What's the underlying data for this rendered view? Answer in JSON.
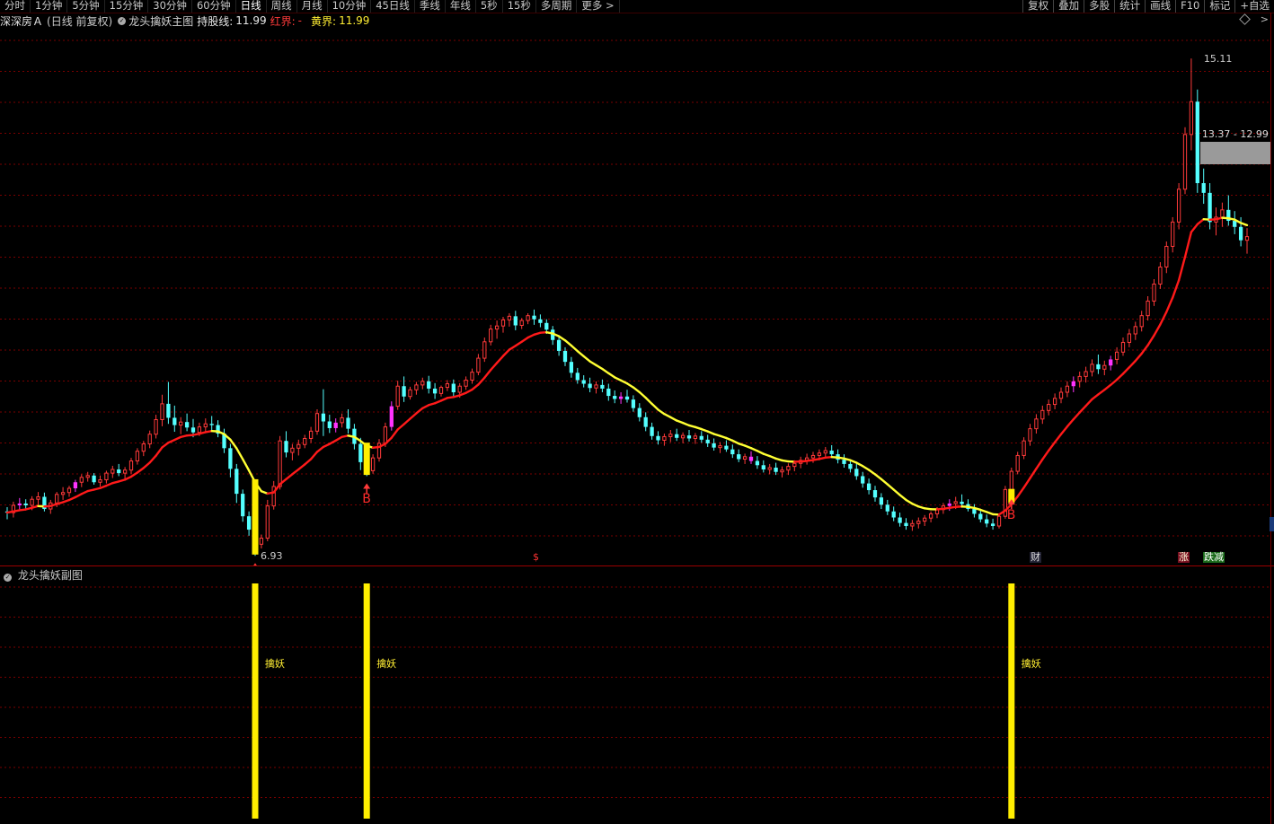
{
  "toolbar": {
    "left_items": [
      "分时",
      "1分钟",
      "5分钟",
      "15分钟",
      "30分钟",
      "60分钟",
      "日线",
      "周线",
      "月线",
      "10分钟",
      "45日线",
      "季线",
      "年线",
      "5秒",
      "15秒",
      "多周期",
      "更多 >"
    ],
    "active_index": 6,
    "right_items": [
      "复权",
      "叠加",
      "多股",
      "统计",
      "画线",
      "F10",
      "标记",
      "+自选"
    ]
  },
  "infobar": {
    "stock": "深深房Ａ",
    "period": "(日线 前复权)",
    "indicator": "龙头擒妖主图",
    "hold_label": "持股线:",
    "hold_value": "11.99",
    "red_label": "红界:",
    "red_value": "-",
    "yellow_label": "黄界:",
    "yellow_value": "11.99"
  },
  "annotations": {
    "low_price": "6.93",
    "high_price": "15.11",
    "range_label": "13.37 - 12.99",
    "buy_letter": "B",
    "dollar_mark": "$",
    "cai_tag": "财",
    "zhang_tag": "涨",
    "jian_tag": "跌减"
  },
  "sub_chart": {
    "title": "龙头擒妖副图",
    "signal_label": "擒妖"
  },
  "colors": {
    "up": "#ff3a3a",
    "down": "#54ffff",
    "highlight": "#ff33ff",
    "signal": "#ffee00",
    "hold_red": "#ff1a1a",
    "hold_yellow": "#ffff33",
    "grid": "#7a0000"
  },
  "chart_data": {
    "type": "candlestick",
    "price_range": [
      6.8,
      15.6
    ],
    "buy_signals": [
      40,
      58,
      162
    ],
    "ohlc": [
      [
        7.66,
        7.73,
        7.53,
        7.64
      ],
      [
        7.64,
        7.82,
        7.56,
        7.76
      ],
      [
        7.76,
        7.88,
        7.67,
        7.79
      ],
      [
        7.79,
        7.86,
        7.7,
        7.76
      ],
      [
        7.76,
        7.91,
        7.68,
        7.86
      ],
      [
        7.86,
        7.98,
        7.77,
        7.9
      ],
      [
        7.9,
        7.97,
        7.66,
        7.7
      ],
      [
        7.7,
        7.85,
        7.62,
        7.8
      ],
      [
        7.8,
        7.98,
        7.73,
        7.94
      ],
      [
        7.94,
        8.06,
        7.85,
        7.97
      ],
      [
        7.97,
        8.08,
        7.9,
        8.04
      ],
      [
        8.04,
        8.18,
        7.98,
        8.14
      ],
      [
        8.14,
        8.27,
        8.06,
        8.22
      ],
      [
        8.22,
        8.31,
        8.15,
        8.25
      ],
      [
        8.25,
        8.29,
        8.1,
        8.14
      ],
      [
        8.14,
        8.25,
        8.07,
        8.18
      ],
      [
        8.18,
        8.33,
        8.12,
        8.29
      ],
      [
        8.29,
        8.41,
        8.21,
        8.35
      ],
      [
        8.35,
        8.44,
        8.24,
        8.29
      ],
      [
        8.29,
        8.39,
        8.19,
        8.34
      ],
      [
        8.34,
        8.54,
        8.28,
        8.49
      ],
      [
        8.49,
        8.7,
        8.43,
        8.65
      ],
      [
        8.65,
        8.82,
        8.57,
        8.77
      ],
      [
        8.77,
        8.99,
        8.7,
        8.93
      ],
      [
        8.93,
        9.25,
        8.86,
        9.17
      ],
      [
        9.17,
        9.58,
        9.06,
        9.43
      ],
      [
        9.43,
        9.79,
        9.1,
        9.2
      ],
      [
        9.2,
        9.4,
        8.97,
        9.08
      ],
      [
        9.08,
        9.21,
        8.93,
        9.13
      ],
      [
        9.13,
        9.27,
        8.98,
        9.04
      ],
      [
        9.04,
        9.18,
        8.88,
        8.96
      ],
      [
        8.96,
        9.12,
        8.9,
        9.05
      ],
      [
        9.05,
        9.19,
        8.97,
        9.1
      ],
      [
        9.1,
        9.23,
        9.0,
        9.08
      ],
      [
        9.08,
        9.16,
        8.88,
        8.94
      ],
      [
        8.94,
        9.02,
        8.62,
        8.7
      ],
      [
        8.7,
        8.77,
        8.22,
        8.36
      ],
      [
        8.36,
        8.44,
        7.8,
        7.95
      ],
      [
        7.95,
        8.02,
        7.49,
        7.58
      ],
      [
        7.58,
        7.66,
        7.26,
        7.36
      ],
      [
        7.36,
        7.45,
        6.93,
        7.12
      ],
      [
        7.12,
        7.28,
        7.05,
        7.22
      ],
      [
        7.22,
        7.85,
        7.17,
        7.75
      ],
      [
        7.75,
        8.16,
        7.69,
        8.07
      ],
      [
        8.07,
        8.9,
        8.02,
        8.82
      ],
      [
        8.82,
        8.98,
        8.55,
        8.63
      ],
      [
        8.63,
        8.77,
        8.5,
        8.7
      ],
      [
        8.7,
        8.84,
        8.58,
        8.76
      ],
      [
        8.76,
        8.92,
        8.7,
        8.86
      ],
      [
        8.86,
        9.05,
        8.79,
        8.98
      ],
      [
        8.98,
        9.34,
        8.92,
        9.27
      ],
      [
        9.27,
        9.67,
        8.9,
        9.14
      ],
      [
        9.14,
        9.25,
        8.95,
        9.03
      ],
      [
        9.03,
        9.19,
        8.96,
        9.12
      ],
      [
        9.12,
        9.27,
        9.04,
        9.2
      ],
      [
        9.2,
        9.34,
        8.94,
        9.02
      ],
      [
        9.02,
        9.1,
        8.68,
        8.77
      ],
      [
        8.77,
        8.87,
        8.34,
        8.47
      ],
      [
        8.47,
        8.56,
        8.24,
        8.33
      ],
      [
        8.33,
        8.6,
        8.28,
        8.54
      ],
      [
        8.54,
        8.85,
        8.48,
        8.78
      ],
      [
        8.78,
        9.12,
        8.72,
        9.05
      ],
      [
        9.05,
        9.47,
        8.99,
        9.39
      ],
      [
        9.39,
        9.81,
        9.33,
        9.72
      ],
      [
        9.72,
        9.88,
        9.46,
        9.55
      ],
      [
        9.55,
        9.71,
        9.5,
        9.66
      ],
      [
        9.66,
        9.79,
        9.58,
        9.74
      ],
      [
        9.74,
        9.86,
        9.67,
        9.8
      ],
      [
        9.8,
        9.89,
        9.6,
        9.68
      ],
      [
        9.68,
        9.77,
        9.51,
        9.6
      ],
      [
        9.6,
        9.73,
        9.55,
        9.7
      ],
      [
        9.7,
        9.82,
        9.64,
        9.76
      ],
      [
        9.76,
        9.83,
        9.55,
        9.62
      ],
      [
        9.62,
        9.77,
        9.53,
        9.72
      ],
      [
        9.72,
        9.88,
        9.66,
        9.82
      ],
      [
        9.82,
        10.01,
        9.76,
        9.95
      ],
      [
        9.95,
        10.25,
        9.9,
        10.18
      ],
      [
        10.18,
        10.52,
        10.12,
        10.45
      ],
      [
        10.45,
        10.73,
        10.39,
        10.66
      ],
      [
        10.66,
        10.8,
        10.5,
        10.71
      ],
      [
        10.71,
        10.86,
        10.6,
        10.81
      ],
      [
        10.81,
        10.92,
        10.7,
        10.87
      ],
      [
        10.87,
        10.96,
        10.64,
        10.72
      ],
      [
        10.72,
        10.84,
        10.66,
        10.8
      ],
      [
        10.8,
        10.92,
        10.74,
        10.88
      ],
      [
        10.88,
        10.98,
        10.73,
        10.82
      ],
      [
        10.82,
        10.9,
        10.69,
        10.76
      ],
      [
        10.76,
        10.82,
        10.58,
        10.65
      ],
      [
        10.65,
        10.71,
        10.4,
        10.48
      ],
      [
        10.48,
        10.55,
        10.22,
        10.3
      ],
      [
        10.3,
        10.36,
        10.05,
        10.12
      ],
      [
        10.12,
        10.2,
        9.86,
        9.94
      ],
      [
        9.94,
        10.02,
        9.76,
        9.82
      ],
      [
        9.82,
        9.9,
        9.7,
        9.76
      ],
      [
        9.76,
        9.86,
        9.62,
        9.69
      ],
      [
        9.69,
        9.8,
        9.6,
        9.74
      ],
      [
        9.74,
        9.83,
        9.62,
        9.68
      ],
      [
        9.68,
        9.76,
        9.48,
        9.56
      ],
      [
        9.56,
        9.65,
        9.44,
        9.51
      ],
      [
        9.51,
        9.62,
        9.43,
        9.55
      ],
      [
        9.55,
        9.66,
        9.45,
        9.5
      ],
      [
        9.5,
        9.57,
        9.3,
        9.36
      ],
      [
        9.36,
        9.44,
        9.14,
        9.21
      ],
      [
        9.21,
        9.29,
        8.98,
        9.05
      ],
      [
        9.05,
        9.12,
        8.84,
        8.9
      ],
      [
        8.9,
        8.98,
        8.76,
        8.83
      ],
      [
        8.83,
        8.94,
        8.74,
        8.89
      ],
      [
        8.89,
        9.0,
        8.8,
        8.93
      ],
      [
        8.93,
        9.02,
        8.82,
        8.87
      ],
      [
        8.87,
        8.96,
        8.78,
        8.91
      ],
      [
        8.91,
        9.0,
        8.81,
        8.86
      ],
      [
        8.86,
        8.95,
        8.77,
        8.9
      ],
      [
        8.9,
        8.98,
        8.79,
        8.84
      ],
      [
        8.84,
        8.92,
        8.72,
        8.78
      ],
      [
        8.78,
        8.86,
        8.66,
        8.71
      ],
      [
        8.71,
        8.8,
        8.62,
        8.74
      ],
      [
        8.74,
        8.83,
        8.64,
        8.68
      ],
      [
        8.68,
        8.76,
        8.54,
        8.6
      ],
      [
        8.6,
        8.68,
        8.47,
        8.52
      ],
      [
        8.52,
        8.61,
        8.44,
        8.56
      ],
      [
        8.56,
        8.65,
        8.44,
        8.49
      ],
      [
        8.49,
        8.57,
        8.36,
        8.42
      ],
      [
        8.42,
        8.5,
        8.3,
        8.35
      ],
      [
        8.35,
        8.44,
        8.27,
        8.38
      ],
      [
        8.38,
        8.46,
        8.26,
        8.31
      ],
      [
        8.31,
        8.4,
        8.22,
        8.34
      ],
      [
        8.34,
        8.45,
        8.26,
        8.4
      ],
      [
        8.4,
        8.5,
        8.32,
        8.45
      ],
      [
        8.45,
        8.56,
        8.37,
        8.5
      ],
      [
        8.5,
        8.61,
        8.43,
        8.54
      ],
      [
        8.54,
        8.64,
        8.46,
        8.58
      ],
      [
        8.58,
        8.68,
        8.5,
        8.62
      ],
      [
        8.62,
        8.72,
        8.54,
        8.66
      ],
      [
        8.66,
        8.75,
        8.55,
        8.6
      ],
      [
        8.6,
        8.68,
        8.45,
        8.51
      ],
      [
        8.51,
        8.6,
        8.38,
        8.44
      ],
      [
        8.44,
        8.52,
        8.3,
        8.36
      ],
      [
        8.36,
        8.44,
        8.18,
        8.24
      ],
      [
        8.24,
        8.31,
        8.05,
        8.12
      ],
      [
        8.12,
        8.2,
        7.94,
        8.01
      ],
      [
        8.01,
        8.08,
        7.82,
        7.89
      ],
      [
        7.89,
        7.96,
        7.7,
        7.77
      ],
      [
        7.77,
        7.85,
        7.6,
        7.66
      ],
      [
        7.66,
        7.74,
        7.5,
        7.56
      ],
      [
        7.56,
        7.64,
        7.41,
        7.47
      ],
      [
        7.47,
        7.55,
        7.36,
        7.42
      ],
      [
        7.42,
        7.52,
        7.34,
        7.46
      ],
      [
        7.46,
        7.56,
        7.38,
        7.5
      ],
      [
        7.5,
        7.6,
        7.42,
        7.55
      ],
      [
        7.55,
        7.66,
        7.48,
        7.62
      ],
      [
        7.62,
        7.73,
        7.55,
        7.69
      ],
      [
        7.69,
        7.8,
        7.62,
        7.75
      ],
      [
        7.75,
        7.86,
        7.67,
        7.79
      ],
      [
        7.79,
        7.9,
        7.7,
        7.82
      ],
      [
        7.82,
        7.94,
        7.72,
        7.78
      ],
      [
        7.78,
        7.86,
        7.66,
        7.7
      ],
      [
        7.7,
        7.78,
        7.56,
        7.62
      ],
      [
        7.62,
        7.7,
        7.48,
        7.53
      ],
      [
        7.53,
        7.61,
        7.4,
        7.46
      ],
      [
        7.46,
        7.54,
        7.36,
        7.42
      ],
      [
        7.42,
        7.62,
        7.38,
        7.58
      ],
      [
        7.58,
        8.08,
        7.54,
        8.02
      ],
      [
        8.02,
        8.38,
        7.98,
        8.32
      ],
      [
        8.32,
        8.64,
        8.27,
        8.58
      ],
      [
        8.58,
        8.88,
        8.52,
        8.82
      ],
      [
        8.82,
        9.1,
        8.74,
        9.02
      ],
      [
        9.02,
        9.26,
        8.94,
        9.18
      ],
      [
        9.18,
        9.4,
        9.1,
        9.32
      ],
      [
        9.32,
        9.5,
        9.24,
        9.42
      ],
      [
        9.42,
        9.6,
        9.34,
        9.52
      ],
      [
        9.52,
        9.7,
        9.44,
        9.62
      ],
      [
        9.62,
        9.8,
        9.54,
        9.72
      ],
      [
        9.72,
        9.88,
        9.62,
        9.8
      ],
      [
        9.8,
        9.96,
        9.7,
        9.88
      ],
      [
        9.88,
        10.04,
        9.78,
        9.96
      ],
      [
        9.96,
        10.16,
        9.88,
        10.08
      ],
      [
        10.08,
        10.24,
        9.92,
        10.0
      ],
      [
        10.0,
        10.14,
        9.9,
        10.06
      ],
      [
        10.06,
        10.22,
        9.98,
        10.16
      ],
      [
        10.16,
        10.36,
        10.08,
        10.28
      ],
      [
        10.28,
        10.52,
        10.22,
        10.44
      ],
      [
        10.44,
        10.66,
        10.36,
        10.58
      ],
      [
        10.58,
        10.78,
        10.48,
        10.7
      ],
      [
        10.7,
        10.96,
        10.62,
        10.88
      ],
      [
        10.88,
        11.2,
        10.8,
        11.12
      ],
      [
        11.12,
        11.48,
        11.04,
        11.4
      ],
      [
        11.4,
        11.76,
        11.32,
        11.68
      ],
      [
        11.68,
        12.1,
        11.58,
        12.02
      ],
      [
        12.02,
        12.5,
        11.92,
        12.42
      ],
      [
        12.42,
        13.06,
        12.3,
        12.96
      ],
      [
        12.96,
        13.98,
        12.88,
        13.86
      ],
      [
        13.86,
        15.11,
        13.6,
        14.4
      ],
      [
        14.4,
        14.6,
        12.9,
        13.06
      ],
      [
        13.06,
        13.3,
        12.72,
        12.9
      ],
      [
        12.9,
        13.06,
        12.3,
        12.42
      ],
      [
        12.42,
        12.66,
        12.2,
        12.5
      ],
      [
        12.5,
        12.74,
        12.34,
        12.62
      ],
      [
        12.62,
        12.86,
        12.36,
        12.44
      ],
      [
        12.44,
        12.6,
        12.22,
        12.34
      ],
      [
        12.34,
        12.5,
        12.02,
        12.12
      ],
      [
        12.12,
        12.32,
        11.9,
        12.18
      ]
    ]
  }
}
